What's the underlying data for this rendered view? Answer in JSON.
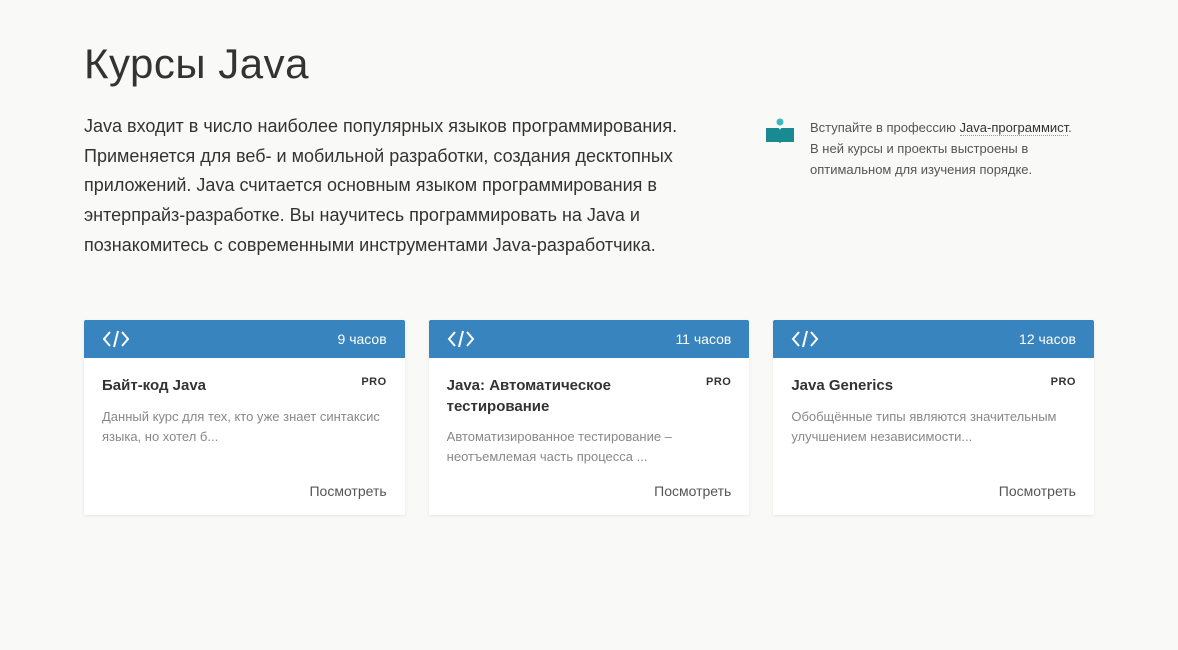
{
  "page": {
    "title": "Курсы Java",
    "description": "Java входит в число наиболее популярных языков программирования. Применяется для веб- и мобильной разработки, создания десктопных приложений. Java считается основным языком программирования в энтерпрайз-разработке. Вы научитесь программировать на Java и познакомитесь с современными инструментами Java-разработчика."
  },
  "sidebar": {
    "prefix": "Вступайте в профессию ",
    "link_text": "Java-программист",
    "suffix": ". В ней курсы и проекты выстроены в оптимальном для изучения порядке."
  },
  "cards": [
    {
      "duration": "9 часов",
      "title": "Байт-код Java",
      "badge": "PRO",
      "description": "Данный курс для тех, кто уже знает синтаксис языка, но хотел б...",
      "action": "Посмотреть"
    },
    {
      "duration": "11 часов",
      "title": "Java: Автоматическое тестирование",
      "badge": "PRO",
      "description": "Автоматизированное тестирование – неотъемлемая часть процесса ...",
      "action": "Посмотреть"
    },
    {
      "duration": "12 часов",
      "title": "Java Generics",
      "badge": "PRO",
      "description": "Обобщённые типы являются значительным улучшением независимости...",
      "action": "Посмотреть"
    }
  ]
}
